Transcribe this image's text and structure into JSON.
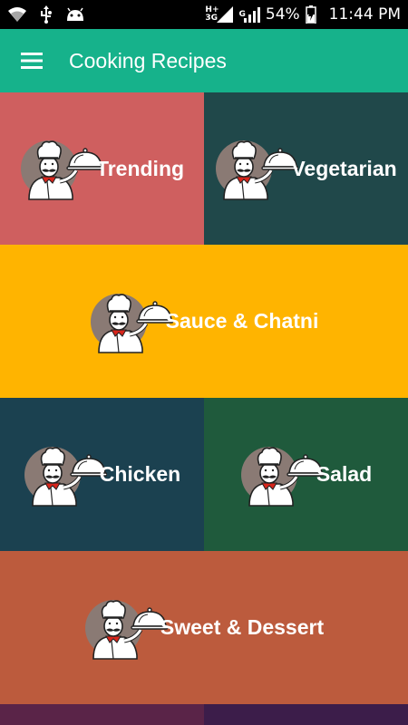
{
  "status_bar": {
    "net1": "H+",
    "net1_sub": "3G",
    "net2": "G",
    "battery": "54%",
    "time": "11:44 PM"
  },
  "app_bar": {
    "title": "Cooking Recipes",
    "menu_icon": "hamburger-menu-icon"
  },
  "categories": [
    {
      "label": "Trending",
      "color": "#cf5f5f",
      "icon": "chef-serving-icon"
    },
    {
      "label": "Vegetarian",
      "color": "#20484a",
      "icon": "chef-serving-icon"
    },
    {
      "label": "Sauce & Chatni",
      "color": "#ffb400",
      "icon": "chef-serving-icon"
    },
    {
      "label": "Chicken",
      "color": "#1b4150",
      "icon": "chef-serving-icon"
    },
    {
      "label": "Salad",
      "color": "#1f5a3c",
      "icon": "chef-serving-icon"
    },
    {
      "label": "Sweet & Dessert",
      "color": "#bc5b3d",
      "icon": "chef-serving-icon"
    }
  ],
  "colors": {
    "app_bar": "#16b28b",
    "status_bar": "#000000",
    "partial_row_left": "#5a2448",
    "partial_row_right": "#3c1d4a"
  }
}
